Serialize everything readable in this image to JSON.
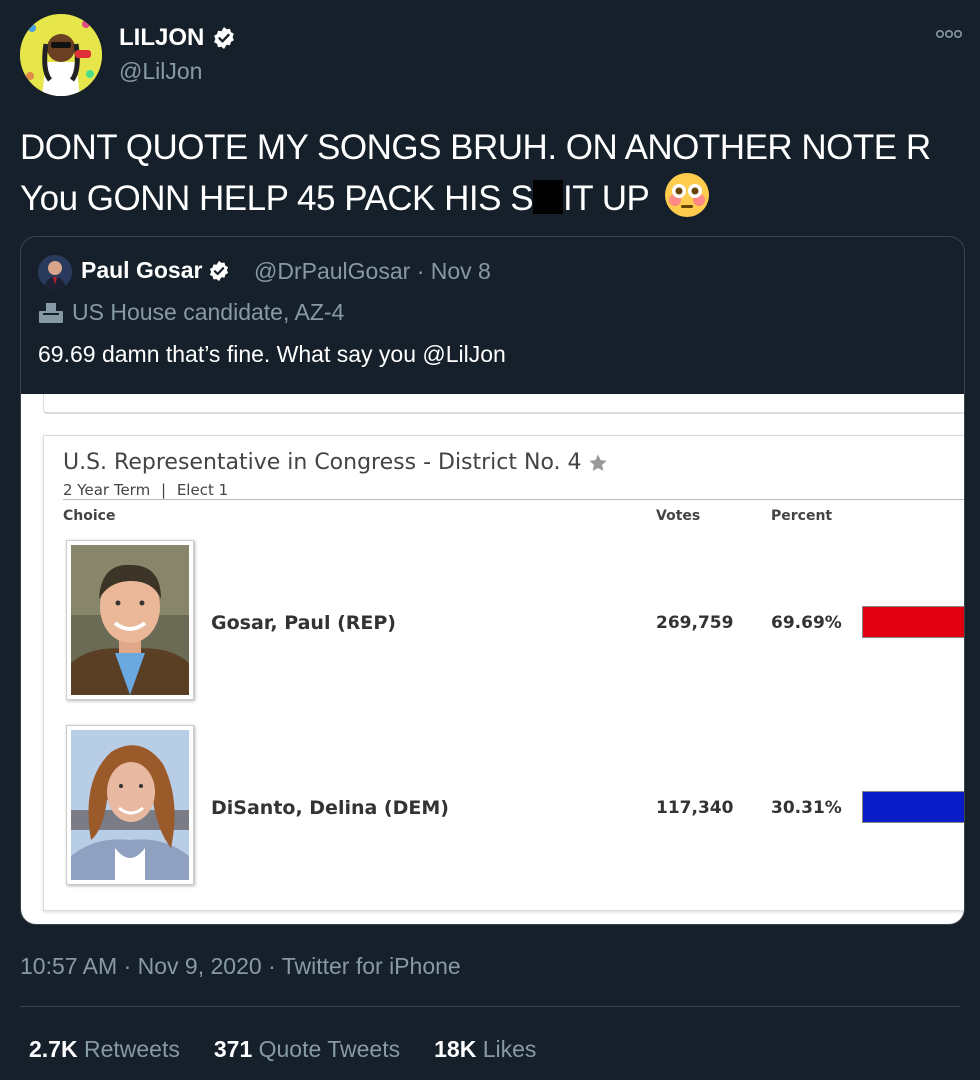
{
  "author": {
    "name": "LILJON",
    "handle": "@LilJon"
  },
  "tweet": {
    "text_before_censor": "DONT QUOTE MY SONGS BRUH. ON ANOTHER NOTE R You GONN HELP 45 PACK HIS S",
    "text_after_censor": "IT UP",
    "emoji": "flushed-face"
  },
  "quoted": {
    "name": "Paul Gosar",
    "handle": "@DrPaulGosar",
    "separator": "·",
    "date": "Nov 8",
    "label": "US House candidate, AZ-4",
    "text": "69.69 damn that’s fine. What say you @LilJon",
    "results": {
      "race_title": "U.S. Representative in Congress - District No. 4",
      "term": "2 Year Term",
      "divider": "|",
      "elect": "Elect 1",
      "headers": {
        "choice": "Choice",
        "votes": "Votes",
        "percent": "Percent"
      },
      "candidates": [
        {
          "name": "Gosar, Paul (REP)",
          "votes": "269,759",
          "percent": "69.69%",
          "bar_color": "#e00012"
        },
        {
          "name": "DiSanto, Delina (DEM)",
          "votes": "117,340",
          "percent": "30.31%",
          "bar_color": "#0a1bc8"
        }
      ]
    }
  },
  "meta": {
    "time": "10:57 AM",
    "sep": "·",
    "date": "Nov 9, 2020",
    "source": "Twitter for iPhone"
  },
  "stats": {
    "retweets_count": "2.7K",
    "retweets_label": "Retweets",
    "quotes_count": "371",
    "quotes_label": "Quote Tweets",
    "likes_count": "18K",
    "likes_label": "Likes"
  },
  "colors": {
    "background": "#15202b",
    "secondary_text": "#8899a6",
    "verified": "#ffffff",
    "border": "#38444d"
  }
}
